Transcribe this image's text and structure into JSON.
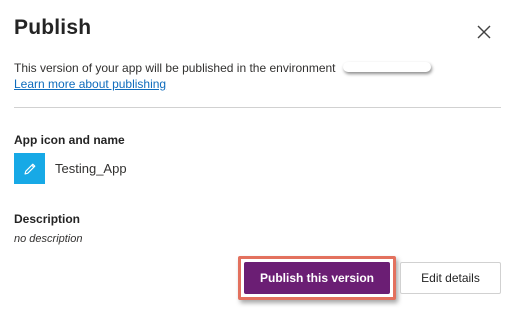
{
  "dialog": {
    "title": "Publish",
    "close_icon": "close-icon",
    "intro_text": "This version of your app will be published in the environment",
    "learn_more_link": "Learn more about publishing"
  },
  "app": {
    "section_label": "App icon and name",
    "icon": "pencil-icon",
    "icon_color": "#17a9e6",
    "name": "Testing_App"
  },
  "description": {
    "section_label": "Description",
    "value": "no description"
  },
  "actions": {
    "publish_label": "Publish this version",
    "publish_color": "#6b1e74",
    "highlight_color": "#e3715e",
    "edit_label": "Edit details"
  }
}
